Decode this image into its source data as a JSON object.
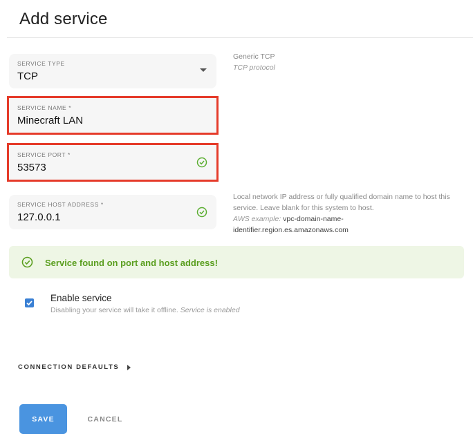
{
  "header": {
    "title": "Add service"
  },
  "form": {
    "service_type": {
      "label": "SERVICE TYPE",
      "value": "TCP"
    },
    "service_name": {
      "label": "SERVICE NAME *",
      "value": "Minecraft LAN"
    },
    "service_port": {
      "label": "SERVICE PORT *",
      "value": "53573"
    },
    "service_host": {
      "label": "SERVICE HOST ADDRESS *",
      "value": "127.0.0.1"
    }
  },
  "help": {
    "type_title": "Generic TCP",
    "type_desc": "TCP protocol",
    "host_line1": "Local network IP address or fully qualified domain name to host this",
    "host_line2": "service. Leave blank for this system to host.",
    "aws_label": "AWS example:",
    "aws_value_line1": "vpc-domain-name-",
    "aws_value_line2": "identifier.region.es.amazonaws.com"
  },
  "alert": {
    "text": "Service found on port and host address!"
  },
  "enable": {
    "checked": true,
    "label": "Enable service",
    "sub": "Disabling your service will take it offline.",
    "status": "Service is enabled"
  },
  "sections": {
    "connection_defaults": "CONNECTION DEFAULTS"
  },
  "actions": {
    "save": "SAVE",
    "cancel": "CANCEL"
  },
  "colors": {
    "accent": "#4a94e0",
    "success": "#5a9e1f",
    "success_bg": "#eef6e5",
    "highlight": "#e53b2a"
  }
}
